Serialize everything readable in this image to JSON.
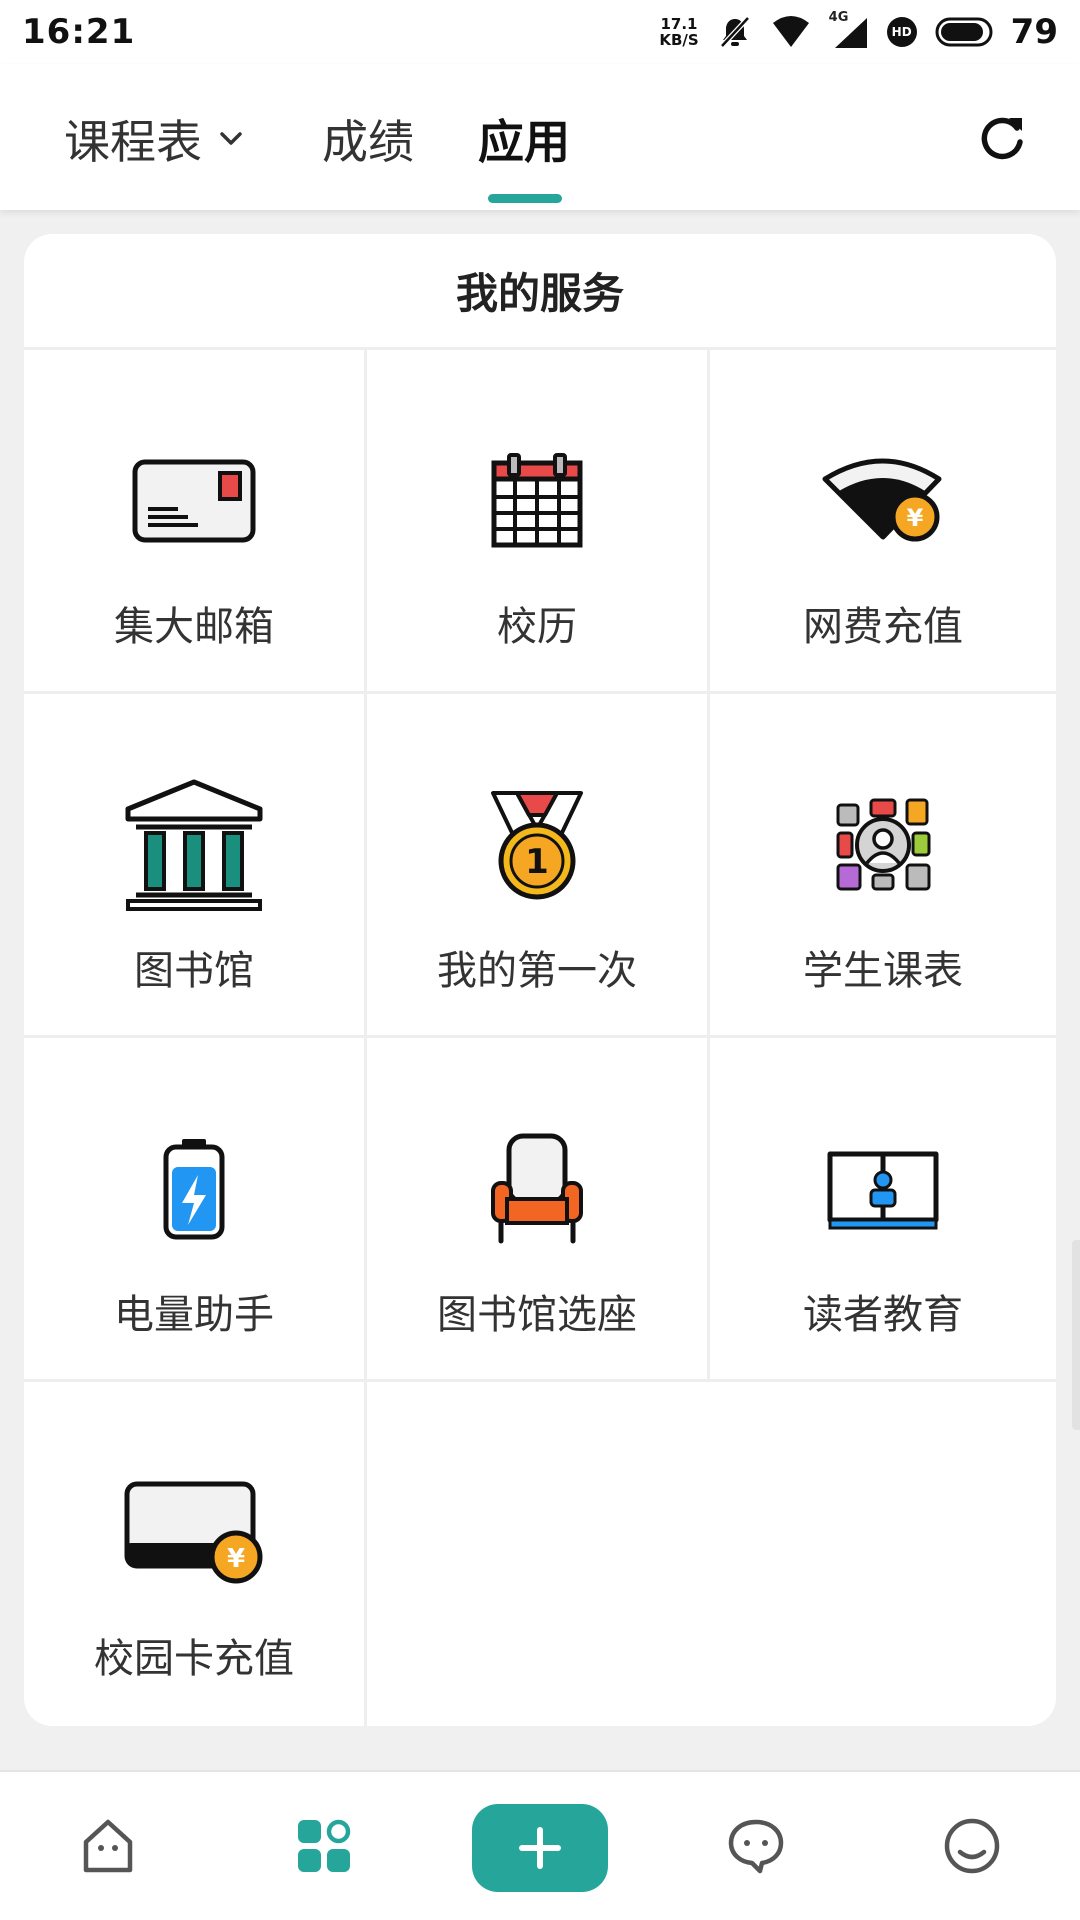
{
  "status_bar": {
    "time": "16:21",
    "net_speed_value": "17.1",
    "net_speed_unit": "KB/S",
    "signal_type": "4G",
    "hd_badge": "HD",
    "battery": "79"
  },
  "top_tabs": [
    {
      "label": "课程表",
      "active": false
    },
    {
      "label": "成绩",
      "active": false
    },
    {
      "label": "应用",
      "active": true
    }
  ],
  "card": {
    "title": "我的服务",
    "services": [
      {
        "label": "集大邮箱",
        "icon": "envelope-icon"
      },
      {
        "label": "校历",
        "icon": "calendar-icon"
      },
      {
        "label": "网费充值",
        "icon": "wifi-payment-icon"
      },
      {
        "label": "图书馆",
        "icon": "library-building-icon"
      },
      {
        "label": "我的第一次",
        "icon": "medal-icon"
      },
      {
        "label": "学生课表",
        "icon": "student-schedule-icon"
      },
      {
        "label": "电量助手",
        "icon": "battery-icon"
      },
      {
        "label": "图书馆选座",
        "icon": "armchair-icon"
      },
      {
        "label": "读者教育",
        "icon": "reader-book-icon"
      },
      {
        "label": "校园卡充值",
        "icon": "campus-card-icon"
      }
    ]
  },
  "bottom_nav": [
    {
      "icon": "home-icon"
    },
    {
      "icon": "apps-icon",
      "active": true
    },
    {
      "icon": "plus-icon"
    },
    {
      "icon": "chat-icon"
    },
    {
      "icon": "profile-face-icon"
    }
  ],
  "colors": {
    "accent": "#26a69a",
    "yuan_coin": "#f5a623"
  }
}
